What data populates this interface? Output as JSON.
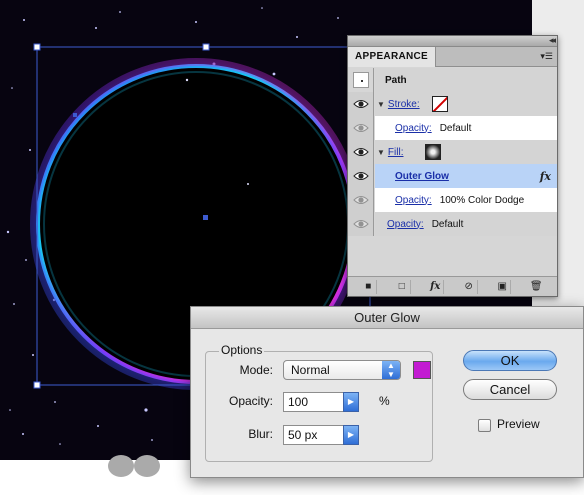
{
  "appearance_panel": {
    "tab_label": "APPEARANCE",
    "collapse_icon": "double-chevron-left",
    "menu_icon": "panel-menu",
    "rows": [
      {
        "kind": "header",
        "label": "Path"
      },
      {
        "kind": "stroke",
        "label": "Stroke:",
        "swatch": "none"
      },
      {
        "kind": "opacity",
        "label": "Opacity:",
        "value": "Default"
      },
      {
        "kind": "fill",
        "label": "Fill:",
        "swatch": "radial-gradient"
      },
      {
        "kind": "effect",
        "label": "Outer Glow",
        "icon": "fx"
      },
      {
        "kind": "opacity",
        "label": "Opacity:",
        "value": "100% Color Dodge"
      },
      {
        "kind": "opacity",
        "label": "Opacity:",
        "value": "Default"
      }
    ],
    "footer_buttons": [
      {
        "name": "add-new-stroke-icon",
        "glyph": "■"
      },
      {
        "name": "add-new-fill-icon",
        "glyph": "□"
      },
      {
        "name": "add-new-effect-icon",
        "glyph": "fx"
      },
      {
        "name": "clear-appearance-icon",
        "glyph": "⊘"
      },
      {
        "name": "duplicate-item-icon",
        "glyph": "▣"
      },
      {
        "name": "delete-item-icon",
        "glyph": "🗑"
      }
    ]
  },
  "dialog": {
    "title": "Outer Glow",
    "group_label": "Options",
    "mode": {
      "label": "Mode:",
      "value": "Normal",
      "options": [
        "Normal"
      ]
    },
    "glow_color": "#c21bd2",
    "opacity": {
      "label": "Opacity:",
      "value": "100",
      "unit": "%"
    },
    "blur": {
      "label": "Blur:",
      "value": "50 px"
    },
    "ok_label": "OK",
    "cancel_label": "Cancel",
    "preview_label": "Preview",
    "preview_checked": false
  },
  "colors": {
    "canvas_background": "#070410",
    "glow_cyan": "#22c3ff",
    "glow_magenta": "#d91bd6",
    "selection_blue": "#3d5bd0"
  }
}
